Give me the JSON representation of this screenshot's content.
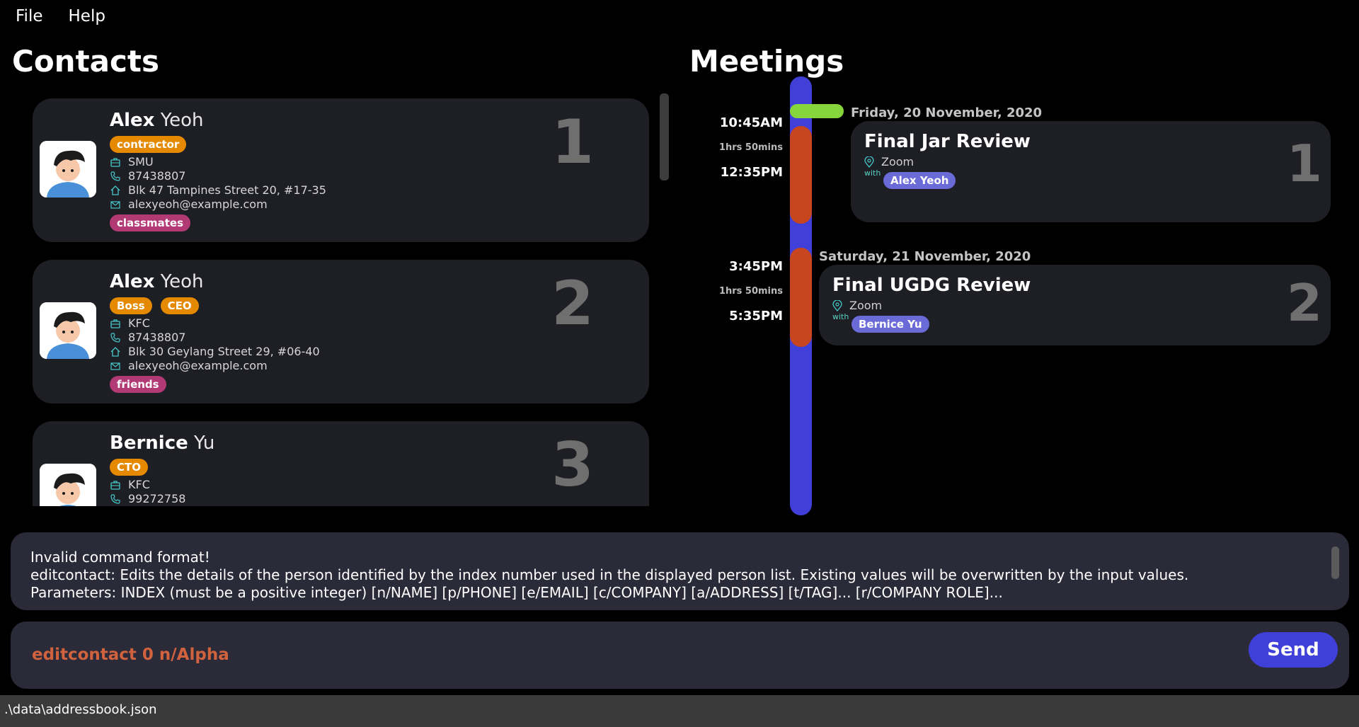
{
  "menu": {
    "file": "File",
    "help": "Help"
  },
  "headings": {
    "contacts": "Contacts",
    "meetings": "Meetings"
  },
  "contacts": [
    {
      "first": "Alex",
      "last": "Yeoh",
      "index": "1",
      "roles": [
        "contractor"
      ],
      "company": "SMU",
      "phone": "87438807",
      "address": "Blk 47 Tampines Street 20, #17-35",
      "email": "alexyeoh@example.com",
      "group": "classmates"
    },
    {
      "first": "Alex",
      "last": "Yeoh",
      "index": "2",
      "roles": [
        "Boss",
        "CEO"
      ],
      "company": "KFC",
      "phone": "87438807",
      "address": "Blk 30 Geylang Street 29, #06-40",
      "email": "alexyeoh@example.com",
      "group": "friends"
    },
    {
      "first": "Bernice",
      "last": "Yu",
      "index": "3",
      "roles": [
        "CTO"
      ],
      "company": "KFC",
      "phone": "99272758"
    }
  ],
  "meetings": [
    {
      "date": "Friday, 20 November, 2020",
      "start": "10:45AM",
      "duration": "1hrs 50mins",
      "end": "12:35PM",
      "title": "Final Jar Review",
      "location": "Zoom",
      "with_label": "with",
      "participant": "Alex Yeoh",
      "index": "1"
    },
    {
      "date": "Saturday, 21 November, 2020",
      "start": "3:45PM",
      "duration": "1hrs 50mins",
      "end": "5:35PM",
      "title": "Final UGDG Review",
      "location": "Zoom",
      "with_label": "with",
      "participant": "Bernice Yu",
      "index": "2"
    }
  ],
  "result": {
    "lines": [
      "Invalid command format!",
      "editcontact: Edits the details of the person identified by the index number used in the displayed person list. Existing values will be overwritten by the input values.",
      "Parameters: INDEX (must be a positive integer) [n/NAME] [p/PHONE] [e/EMAIL] [c/COMPANY] [a/ADDRESS] [t/TAG]... [r/COMPANY ROLE]..."
    ]
  },
  "command": {
    "value": "editcontact 0 n/Alpha",
    "send_label": "Send"
  },
  "status": {
    "path": ".\\data\\addressbook.json"
  },
  "colors": {
    "background": "#000000",
    "card": "#1e1e25",
    "role_tag": "#e58a00",
    "group_tag": "#b13a75",
    "participant_tag": "#6b6bd8",
    "timeline": "#4040d8",
    "timeline_meeting": "#c7461f",
    "timeline_flag": "#86d53c",
    "command_text": "#d0623e",
    "send_button": "#3f3fd9",
    "icon": "#45c8c8"
  },
  "icons": {
    "company": "briefcase-icon",
    "phone": "phone-icon",
    "address": "home-icon",
    "email": "envelope-icon",
    "location": "map-pin-icon"
  }
}
